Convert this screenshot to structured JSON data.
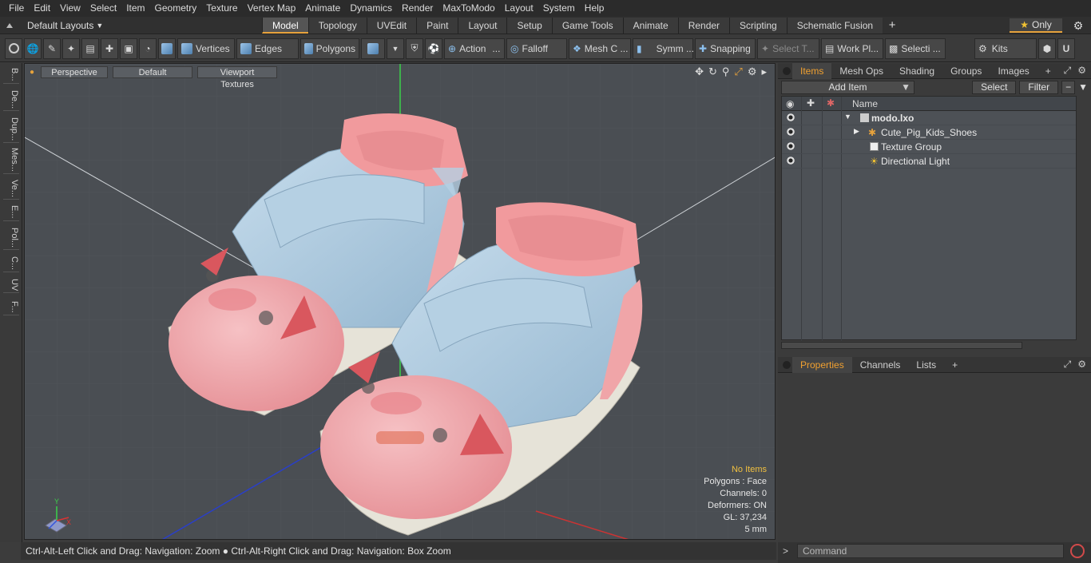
{
  "menu": [
    "File",
    "Edit",
    "View",
    "Select",
    "Item",
    "Geometry",
    "Texture",
    "Vertex Map",
    "Animate",
    "Dynamics",
    "Render",
    "MaxToModo",
    "Layout",
    "System",
    "Help"
  ],
  "layout_selector": "Default Layouts",
  "tabs": [
    {
      "label": "Model",
      "active": true
    },
    {
      "label": "Topology",
      "active": false
    },
    {
      "label": "UVEdit",
      "active": false
    },
    {
      "label": "Paint",
      "active": false
    },
    {
      "label": "Layout",
      "active": false
    },
    {
      "label": "Setup",
      "active": false
    },
    {
      "label": "Game Tools",
      "active": false
    },
    {
      "label": "Animate",
      "active": false
    },
    {
      "label": "Render",
      "active": false
    },
    {
      "label": "Scripting",
      "active": false
    },
    {
      "label": "Schematic Fusion",
      "active": false
    }
  ],
  "only_label": "Only",
  "toolbar": {
    "vertices": "Vertices",
    "edges": "Edges",
    "polygons": "Polygons",
    "action": "Action",
    "falloff": "Falloff",
    "meshc": "Mesh C ...",
    "symm": "Symm ...",
    "snapping": "Snapping",
    "selectt": "Select T...",
    "workpl": "Work Pl...",
    "selecti": "Selecti ...",
    "kits": "Kits"
  },
  "left_strip": [
    "B...",
    "De...",
    "Dup...",
    "Mes...",
    "Ve...",
    "E...",
    "Pol...",
    "C...",
    "UV",
    "F..."
  ],
  "viewport": {
    "view_label": "Perspective",
    "shading_label": "Default",
    "texture_label": "Viewport Textures",
    "info": {
      "selection": "No Items",
      "polygons": "Polygons : Face",
      "channels": "Channels: 0",
      "deformers": "Deformers: ON",
      "gl": "GL: 37,234",
      "size": "5 mm"
    }
  },
  "status_text": "Ctrl-Alt-Left Click and Drag: Navigation: Zoom ● Ctrl-Alt-Right Click and Drag: Navigation: Box Zoom",
  "items_panel": {
    "tabs": [
      "Items",
      "Mesh Ops",
      "Shading",
      "Groups",
      "Images"
    ],
    "add_item": "Add Item",
    "select": "Select",
    "filter": "Filter",
    "name_col": "Name",
    "rows": [
      {
        "label": "modo.lxo",
        "bold": true
      },
      {
        "label": "Cute_Pig_Kids_Shoes"
      },
      {
        "label": "Texture Group"
      },
      {
        "label": "Directional Light"
      }
    ]
  },
  "props_panel": {
    "tabs": [
      "Properties",
      "Channels",
      "Lists"
    ]
  },
  "command_placeholder": "Command",
  "colors": {
    "accent": "#e6a23c",
    "shoe_blue": "#a9c8de",
    "shoe_pink": "#f0a5a8",
    "sole": "#e6e3d8"
  }
}
